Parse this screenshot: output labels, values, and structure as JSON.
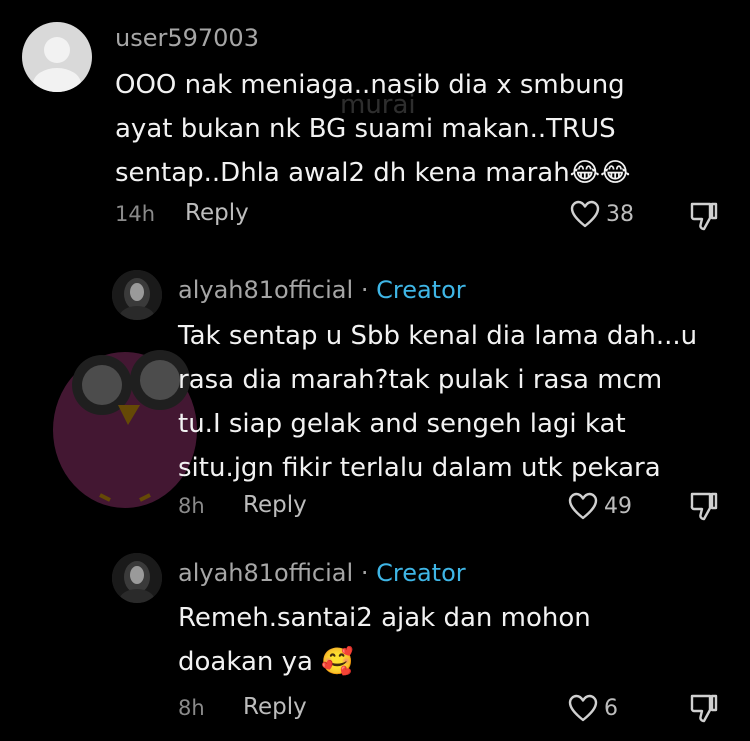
{
  "watermark": {
    "text": "murai"
  },
  "comments": [
    {
      "username": "user597003",
      "text_lines": [
        "OOO nak meniaga..nasib dia x smbung",
        "ayat bukan nk BG suami makan..TRUS",
        "sentap..Dhla awal2 dh kena marah"
      ],
      "emoji": "😂😂",
      "time": "14h",
      "reply_label": "Reply",
      "likes": "38"
    },
    {
      "username": "alyah81official",
      "separator": "·",
      "badge": "Creator",
      "text_lines": [
        "Tak sentap u Sbb kenal dia lama dah...u",
        "rasa dia marah?tak pulak i rasa mcm",
        "tu.I siap gelak and sengeh lagi kat",
        "situ.jgn fikir terlalu dalam utk pekara"
      ],
      "time": "8h",
      "reply_label": "Reply",
      "likes": "49"
    },
    {
      "username": "alyah81official",
      "separator": "·",
      "badge": "Creator",
      "text_lines": [
        "Remeh.santai2 ajak dan mohon",
        "doakan ya"
      ],
      "emoji": "🥰",
      "time": "8h",
      "reply_label": "Reply",
      "likes": "6"
    }
  ],
  "icons": {
    "like": "heart-outline-icon",
    "dislike": "thumbs-down-icon"
  },
  "colors": {
    "background": "#000000",
    "creator_badge": "#3fb6e6",
    "meta": "#8a8a8a"
  }
}
